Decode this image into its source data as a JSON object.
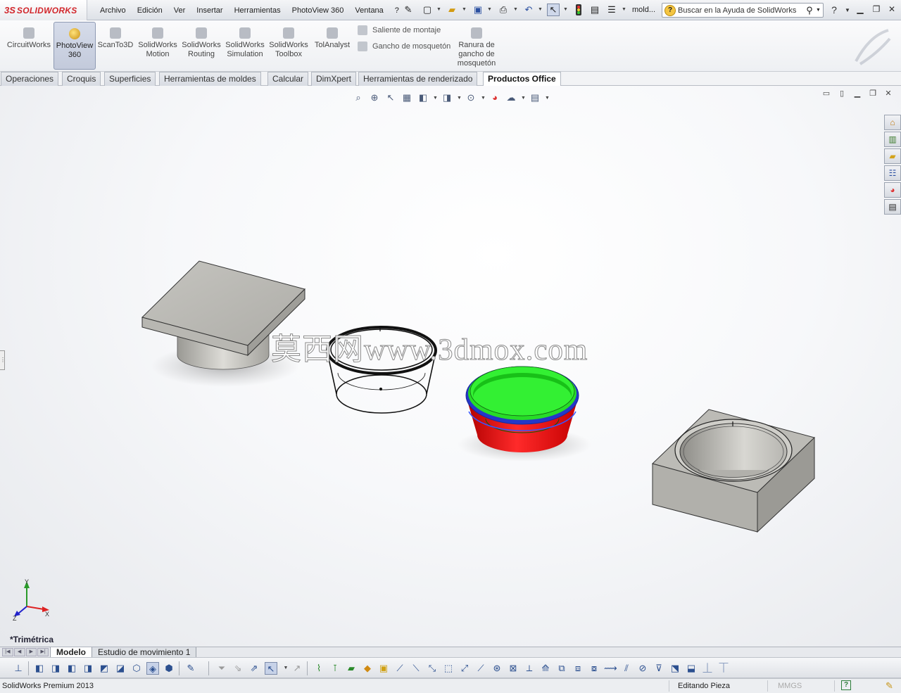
{
  "app": {
    "logo_prefix": "3S",
    "logo_text": "SOLIDWORKS",
    "file_name": "mold...",
    "search_placeholder": "Buscar en la Ayuda de SolidWorks"
  },
  "menu": [
    "Archivo",
    "Edición",
    "Ver",
    "Insertar",
    "Herramientas",
    "PhotoView 360",
    "Ventana",
    "?"
  ],
  "ribbon": {
    "buttons": [
      {
        "label": "CircuitWorks",
        "active": false
      },
      {
        "label": "PhotoView 360",
        "active": true
      },
      {
        "label": "ScanTo3D",
        "active": false
      },
      {
        "label": "SolidWorks Motion",
        "active": false
      },
      {
        "label": "SolidWorks Routing",
        "active": false
      },
      {
        "label": "SolidWorks Simulation",
        "active": false
      },
      {
        "label": "SolidWorks Toolbox",
        "active": false
      },
      {
        "label": "TolAnalyst",
        "active": false
      }
    ],
    "small_buttons": [
      "Saliente de montaje",
      "Gancho de mosquetón"
    ],
    "slot_button": "Ranura de gancho de mosquetón"
  },
  "tabs": [
    "Operaciones",
    "Croquis",
    "Superficies",
    "Herramientas de moldes",
    "Calcular",
    "DimXpert",
    "Herramientas de renderizado",
    "Productos Office"
  ],
  "active_tab": "Productos Office",
  "viewport": {
    "watermark": "莫西网www.3dmox.com",
    "view_name": "*Trimétrica",
    "triad": {
      "x": "X",
      "y": "Y",
      "z": "Z"
    },
    "colors": {
      "cavity_green": "#19e619",
      "core_red": "#e01010",
      "parting_blue": "#2a3fd6",
      "solid_grey": "#b9b8b3"
    }
  },
  "bottom_tabs": [
    "Modelo",
    "Estudio de movimiento 1"
  ],
  "status": {
    "product": "SolidWorks Premium 2013",
    "mode": "Editando Pieza",
    "units": "MMGS",
    "help_glyph": "?"
  }
}
